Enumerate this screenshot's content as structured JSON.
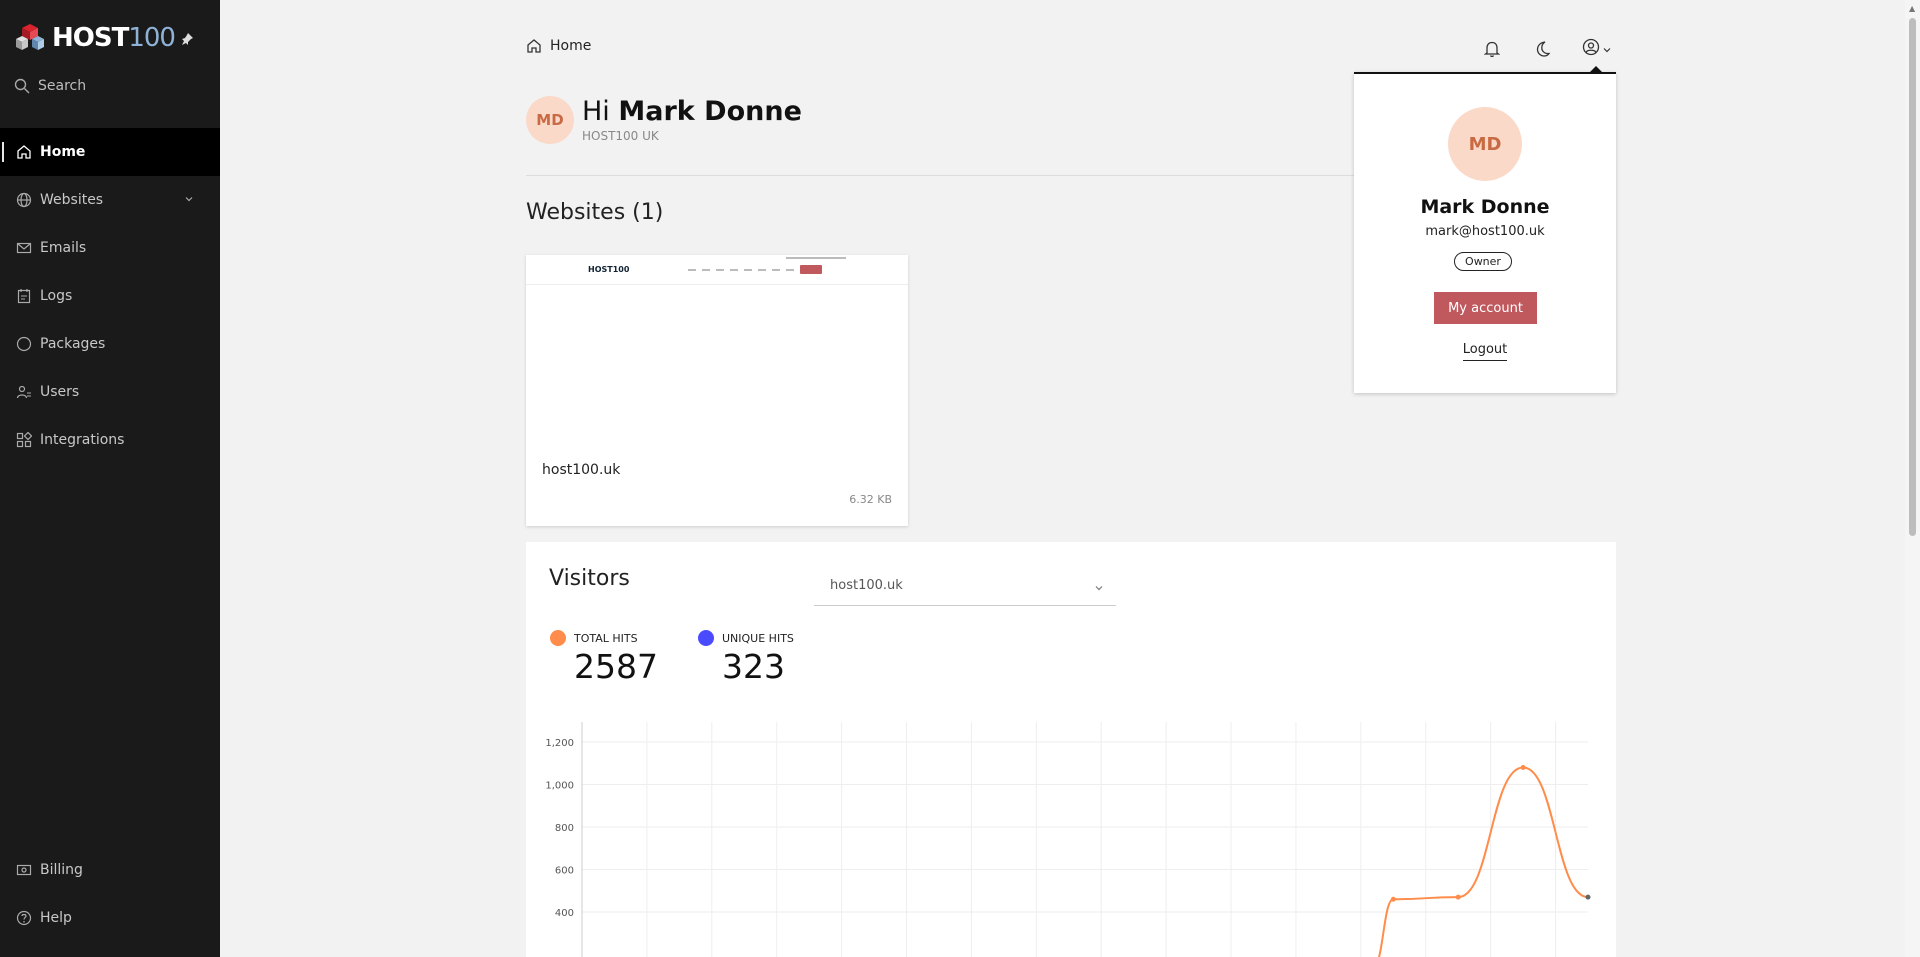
{
  "brand": {
    "name": "HOST",
    "name_num": "100"
  },
  "sidebar": {
    "search_label": "Search",
    "items": [
      {
        "label": "Home"
      },
      {
        "label": "Websites"
      },
      {
        "label": "Emails"
      },
      {
        "label": "Logs"
      },
      {
        "label": "Packages"
      },
      {
        "label": "Users"
      },
      {
        "label": "Integrations"
      }
    ],
    "bottom_items": [
      {
        "label": "Billing"
      },
      {
        "label": "Help"
      }
    ]
  },
  "header": {
    "breadcrumb": "Home"
  },
  "greeting": {
    "initials": "MD",
    "hi": "Hi",
    "name": "Mark Donne",
    "company": "HOST100 UK"
  },
  "websites": {
    "title": "Websites (1)",
    "items": [
      {
        "name": "host100.uk",
        "size": "6.32 KB",
        "thumb_logo": "HOST100"
      }
    ]
  },
  "visitors": {
    "title": "Visitors",
    "selected_site": "host100.uk",
    "total_label": "TOTAL HITS",
    "total_value": "2587",
    "unique_label": "UNIQUE HITS",
    "unique_value": "323",
    "colors": {
      "total": "#ff8c4a",
      "unique": "#4a4aff"
    }
  },
  "user_menu": {
    "initials": "MD",
    "name": "Mark Donne",
    "email": "mark@host100.uk",
    "role": "Owner",
    "account_label": "My account",
    "logout_label": "Logout"
  },
  "chart_data": {
    "type": "line",
    "y_ticks": [
      "1,200",
      "1,000",
      "800",
      "600",
      "400"
    ],
    "ylim_visible": [
      400,
      1200
    ],
    "grid": true,
    "series": [
      {
        "color": "#ff8c4a",
        "points_visible": [
          {
            "idx": 12,
            "y": 460
          },
          {
            "idx": 13,
            "y": 470
          },
          {
            "idx": 14,
            "y": 1080
          },
          {
            "idx": 15,
            "y": 470
          }
        ]
      }
    ]
  }
}
